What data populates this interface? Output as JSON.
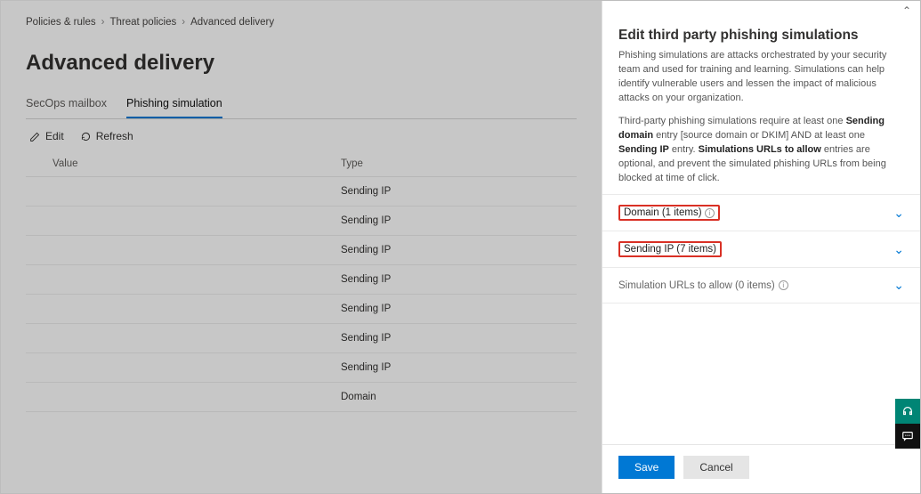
{
  "breadcrumb": {
    "a": "Policies & rules",
    "b": "Threat policies",
    "c": "Advanced delivery"
  },
  "page_title": "Advanced delivery",
  "tabs": {
    "secops": "SecOps mailbox",
    "phish": "Phishing simulation"
  },
  "actions": {
    "edit": "Edit",
    "refresh": "Refresh"
  },
  "table": {
    "headers": {
      "value": "Value",
      "type": "Type"
    },
    "rows": [
      {
        "type": "Sending IP"
      },
      {
        "type": "Sending IP"
      },
      {
        "type": "Sending IP"
      },
      {
        "type": "Sending IP"
      },
      {
        "type": "Sending IP"
      },
      {
        "type": "Sending IP"
      },
      {
        "type": "Sending IP"
      },
      {
        "type": "Domain"
      }
    ]
  },
  "panel": {
    "title": "Edit third party phishing simulations",
    "desc1": "Phishing simulations are attacks orchestrated by your security team and used for training and learning. Simulations can help identify vulnerable users and lessen the impact of malicious attacks on your organization.",
    "desc2a": "Third-party phishing simulations require at least one ",
    "desc2b": "Sending domain",
    "desc2c": " entry [source domain or DKIM] AND at least one ",
    "desc2d": "Sending IP",
    "desc2e": " entry. ",
    "desc2f": "Simulations URLs to allow",
    "desc2g": " entries are optional, and prevent the simulated phishing URLs from being blocked at time of click.",
    "acc_domain": "Domain (1 items)",
    "acc_ip": "Sending IP (7 items)",
    "acc_urls": "Simulation URLs to allow (0 items)",
    "save": "Save",
    "cancel": "Cancel"
  }
}
